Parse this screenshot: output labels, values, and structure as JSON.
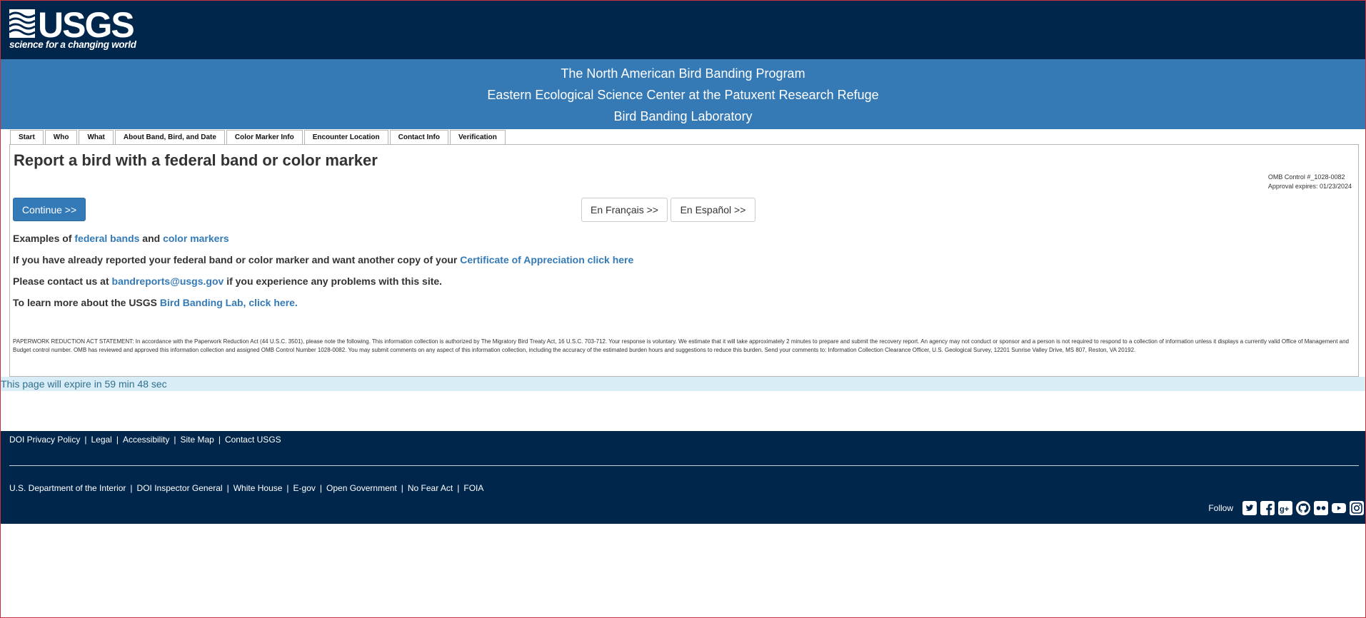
{
  "header": {
    "logo_text": "USGS",
    "logo_tagline": "science for a changing world",
    "background": "#00264c"
  },
  "program": {
    "line1": "The North American Bird Banding Program",
    "line2": "Eastern Ecological Science Center at the Patuxent Research Refuge",
    "line3": "Bird Banding Laboratory",
    "background": "#3579b5"
  },
  "tabs": [
    {
      "label": "Start"
    },
    {
      "label": "Who"
    },
    {
      "label": "What"
    },
    {
      "label": "About Band, Bird, and Date"
    },
    {
      "label": "Color Marker Info"
    },
    {
      "label": "Encounter Location"
    },
    {
      "label": "Contact Info"
    },
    {
      "label": "Verification"
    }
  ],
  "main": {
    "title": "Report a bird with a federal band or color marker",
    "omb_control": "OMB Control #_1028-0082",
    "approval_expires": "Approval expires: 01/23/2024",
    "continue_label": "Continue >>",
    "french_label": "En Français >>",
    "spanish_label": "En Español >>",
    "examples": {
      "prefix": "Examples of ",
      "link1": "federal bands",
      "mid": " and ",
      "link2": "color markers"
    },
    "certificate": {
      "text": "If you have already reported your federal band or color marker and want another copy of your ",
      "link": "Certificate of Appreciation click here"
    },
    "contact": {
      "prefix": "Please contact us at ",
      "email": "bandreports@usgs.gov",
      "suffix": " if you experience any problems with this site."
    },
    "learn": {
      "prefix": "To learn more about the USGS ",
      "link": "Bird Banding Lab, click here."
    },
    "paperwork": "PAPERWORK REDUCTION ACT STATEMENT: In accordance with the Paperwork Reduction Act (44 U.S.C. 3501), please note the following. This information collection is authorized by The Migratory Bird Treaty Act, 16 U.S.C. 703-712. Your response is voluntary. We estimate that it will take approximately 2 minutes to prepare and submit the recovery report. An agency may not conduct or sponsor and a person is not required to respond to a collection of information unless it displays a currently valid Office of Management and Budget control number. OMB has reviewed and approved this information collection and assigned OMB Control Number 1028-0082. You may submit comments on any aspect of this information collection, including the accuracy of the estimated burden hours and suggestions to reduce this burden. Send your comments to: Information Collection Clearance Officer, U.S. Geological Survey, 12201 Sunrise Valley Drive, MS 807, Reston, VA 20192."
  },
  "expire": {
    "text": "This page will expire in 59 min 48 sec"
  },
  "footer": {
    "row1": [
      "DOI Privacy Policy",
      "Legal",
      "Accessibility",
      "Site Map",
      "Contact USGS"
    ],
    "row2": [
      "U.S. Department of the Interior",
      "DOI Inspector General",
      "White House",
      "E-gov",
      "Open Government",
      "No Fear Act",
      "FOIA"
    ],
    "separator": "|",
    "follow_label": "Follow",
    "social_icons": [
      "twitter-icon",
      "facebook-icon",
      "google-plus-icon",
      "github-icon",
      "flickr-icon",
      "youtube-icon",
      "instagram-icon"
    ]
  },
  "colors": {
    "link": "#337ab7",
    "primary_button": "#337ab7",
    "expire_bg": "#d9edf7",
    "expire_text": "#31708f"
  }
}
